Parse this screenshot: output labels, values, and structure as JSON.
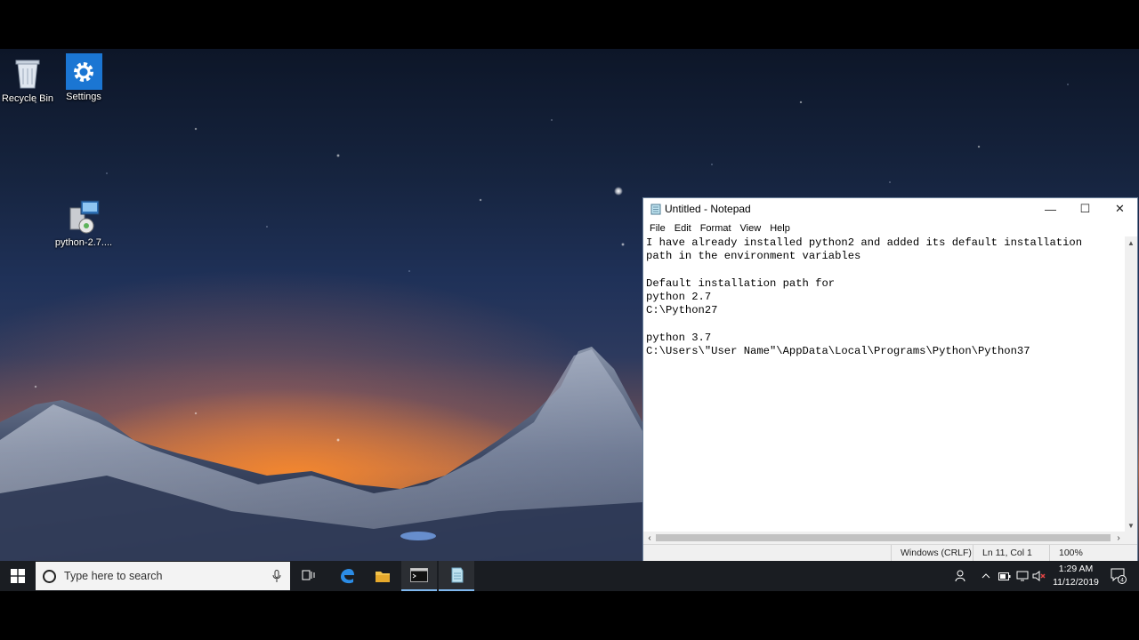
{
  "desktop": {
    "icons": [
      {
        "label": "Recycle Bin"
      },
      {
        "label": "Settings"
      },
      {
        "label": "python-2.7...."
      }
    ]
  },
  "notepad": {
    "title": "Untitled - Notepad",
    "window_controls": {
      "minimize": "—",
      "maximize": "☐",
      "close": "✕"
    },
    "menu": [
      "File",
      "Edit",
      "Format",
      "View",
      "Help"
    ],
    "content": "I have already installed python2 and added its default installation\npath in the environment variables\n\nDefault installation path for\npython 2.7\nC:\\Python27\n\npython 3.7\nC:\\Users\\\"User Name\"\\AppData\\Local\\Programs\\Python\\Python37",
    "status": {
      "encoding": "Windows (CRLF)",
      "position": "Ln 11, Col 1",
      "zoom": "100%"
    }
  },
  "taskbar": {
    "search_placeholder": "Type here to search",
    "apps": [
      "task-view",
      "edge",
      "file-explorer",
      "command-prompt",
      "notepad"
    ],
    "clock": {
      "time": "1:29 AM",
      "date": "11/12/2019"
    },
    "notification_count": "4"
  },
  "colors": {
    "taskbar_bg": "#1a1d22",
    "accent": "#7fb8ef",
    "settings_tile": "#1b76d3"
  }
}
